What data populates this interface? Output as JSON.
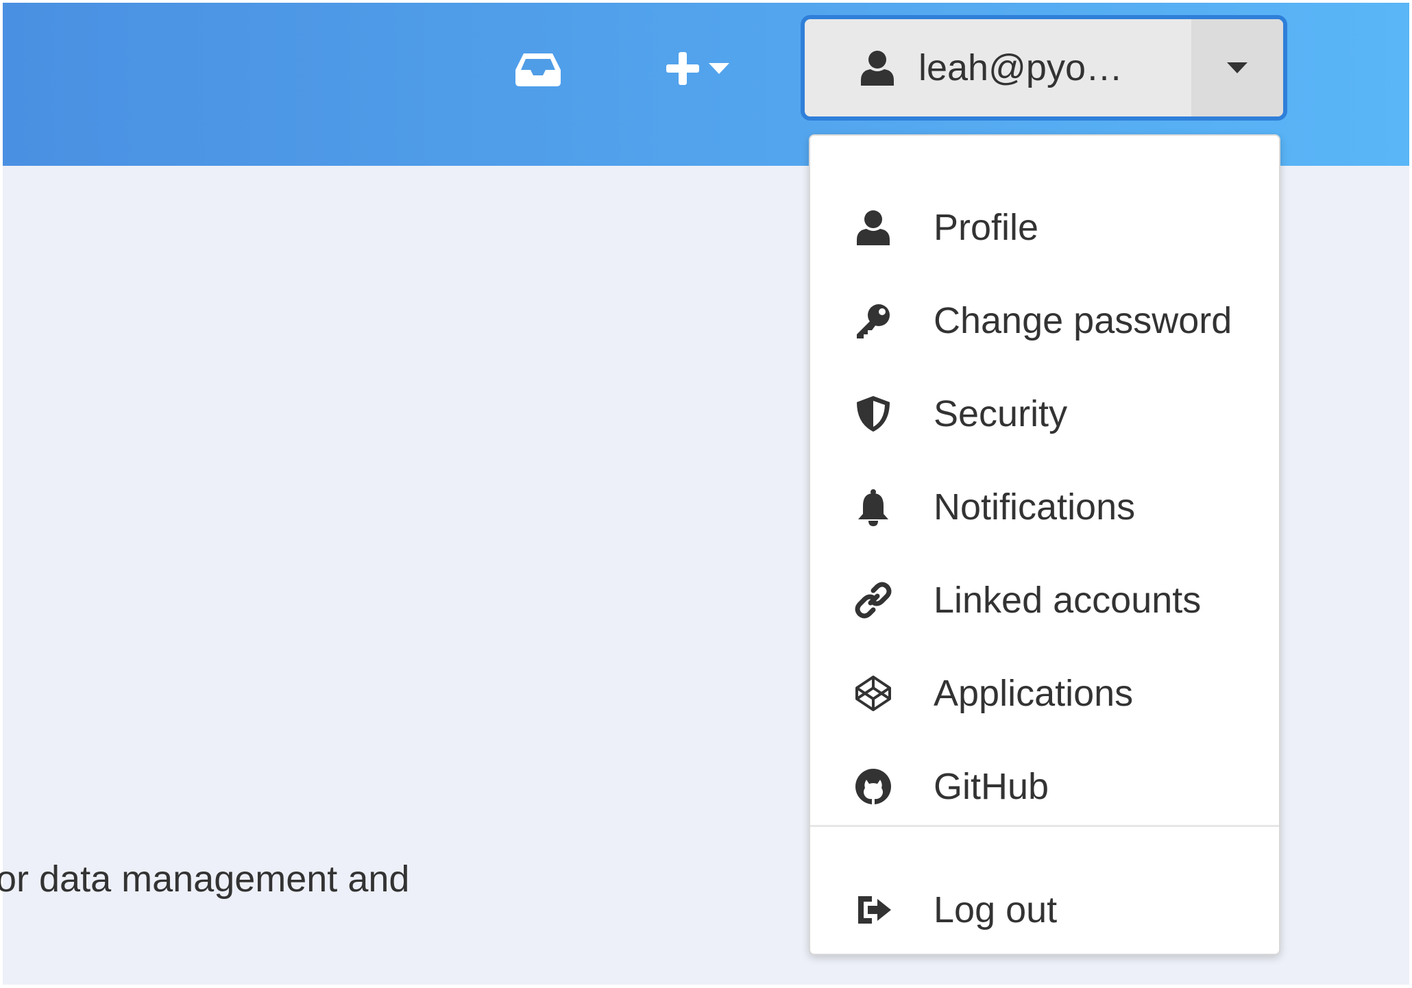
{
  "header": {
    "inbox_icon": "inbox-icon",
    "create_icon": "plus-icon",
    "user_menu": {
      "email": "leah@pyo…",
      "user_icon": "user-icon",
      "caret_icon": "caret-down-icon"
    }
  },
  "dropdown": {
    "items": [
      {
        "label": "Profile",
        "icon": "user-icon"
      },
      {
        "label": "Change password",
        "icon": "key-icon"
      },
      {
        "label": "Security",
        "icon": "shield-icon"
      },
      {
        "label": "Notifications",
        "icon": "bell-icon"
      },
      {
        "label": "Linked accounts",
        "icon": "link-icon"
      },
      {
        "label": "Applications",
        "icon": "codepen-icon"
      },
      {
        "label": "GitHub",
        "icon": "github-icon"
      }
    ],
    "logout": {
      "label": "Log out",
      "icon": "sign-out-icon"
    }
  },
  "content": {
    "partial_text": "or data management and"
  },
  "colors": {
    "header_start": "#4a90e2",
    "header_end": "#5ab6f7",
    "content_bg": "#edf0f8",
    "text": "#333333",
    "focus_border": "#2f7fd9"
  }
}
